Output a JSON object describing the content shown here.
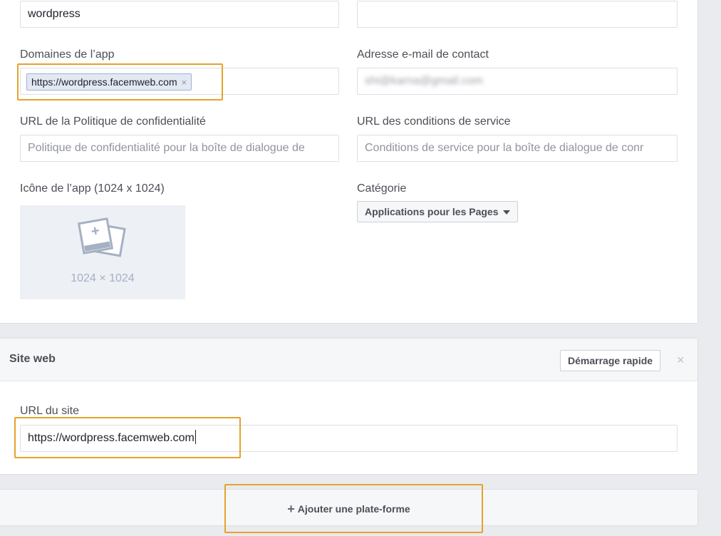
{
  "basic": {
    "display_name_value": "wordpress",
    "namespace_value": "",
    "app_domains_label": "Domaines de l’app",
    "app_domain_tag": "https://wordpress.facemweb.com",
    "tag_remove": "×",
    "contact_email_label": "Adresse e-mail de contact",
    "contact_email_value": "shi@karna@gmail.com",
    "privacy_label": "URL de la Politique de confidentialité",
    "privacy_placeholder": "Politique de confidentialité pour la boîte de dialogue de",
    "terms_label": "URL des conditions de service",
    "terms_placeholder": "Conditions de service pour la boîte de dialogue de conr",
    "icon_label": "Icône de l’app (1024 x 1024)",
    "icon_size_text": "1024 × 1024",
    "category_label": "Catégorie",
    "category_value": "Applications pour les Pages"
  },
  "website": {
    "title": "Site web",
    "quick_start_label": "Démarrage rapide",
    "close_label": "×",
    "site_url_label": "URL du site",
    "site_url_value": "https://wordpress.facemweb.com"
  },
  "add_platform": {
    "plus": "+",
    "label": "Ajouter une plate-forme"
  },
  "colors": {
    "highlight": "#e4a32b",
    "tag_background": "#e3e8f3",
    "icon_placeholder": "#a5b0c3"
  }
}
